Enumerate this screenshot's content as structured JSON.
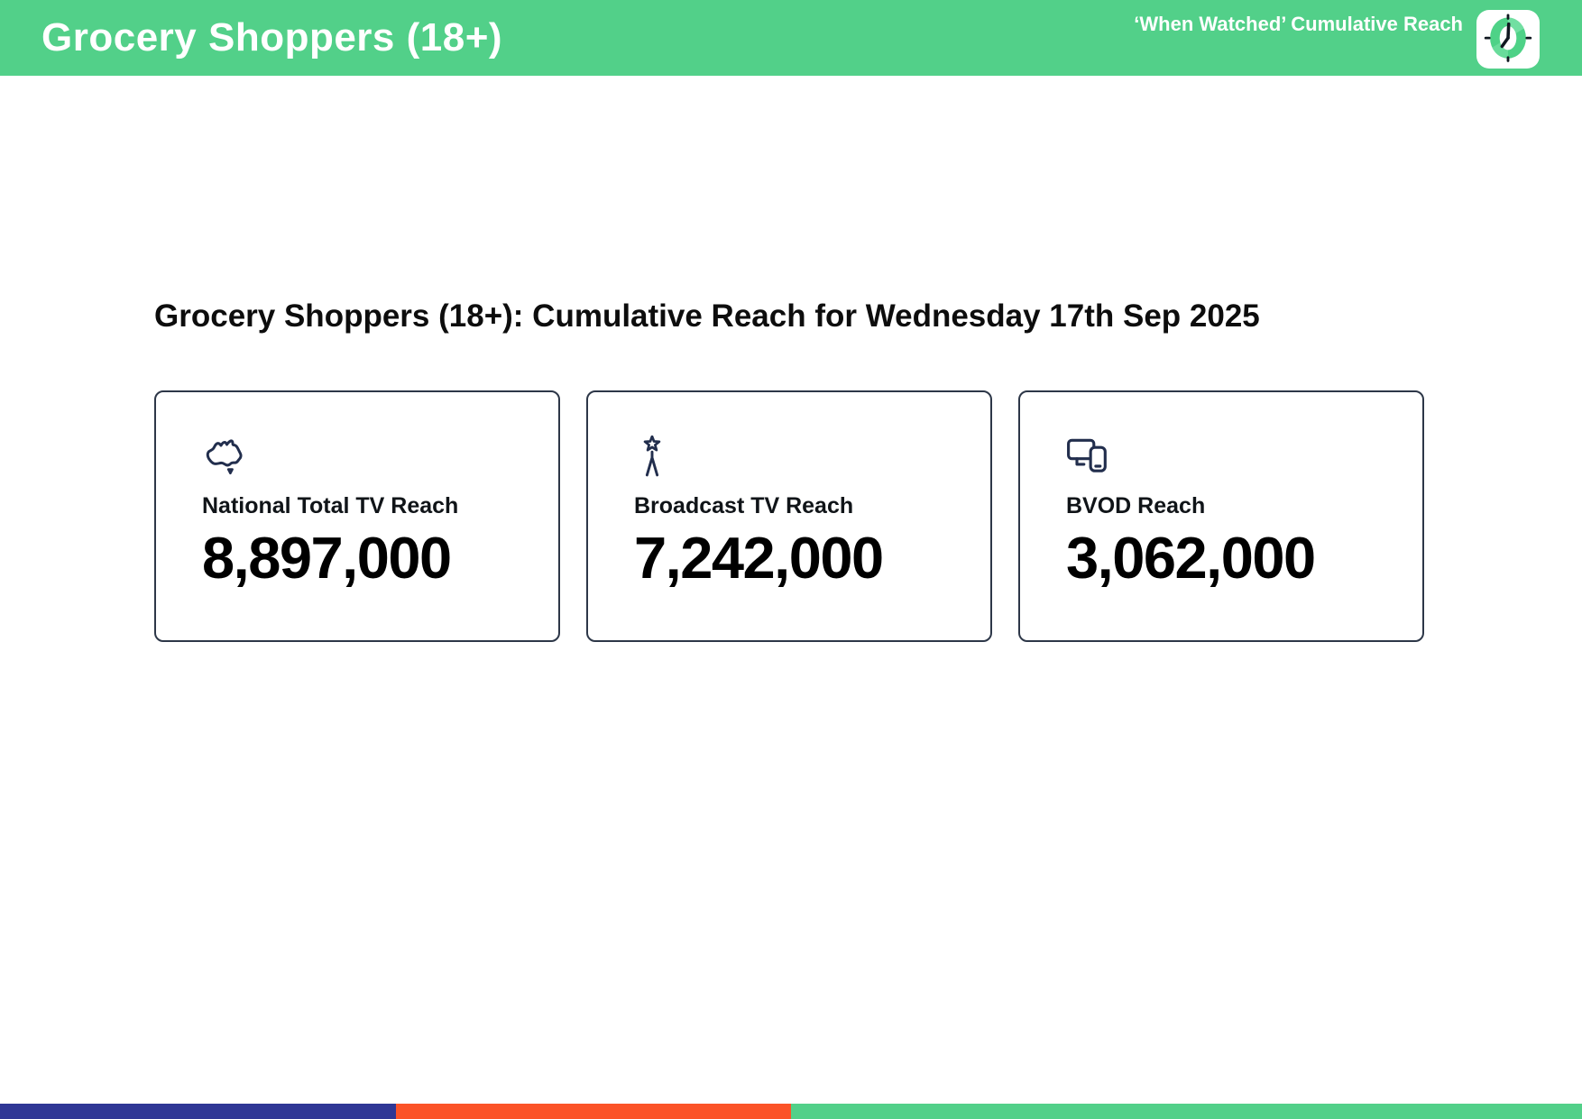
{
  "header": {
    "title": "Grocery Shoppers (18+)",
    "subtitle": "‘When Watched’ Cumulative Reach",
    "clock_icon": "clock-in-rounded-square"
  },
  "main": {
    "heading": "Grocery Shoppers (18+): Cumulative Reach for Wednesday 17th Sep 2025",
    "cards": [
      {
        "icon": "australia-map-icon",
        "label": "National Total TV Reach",
        "value": "8,897,000"
      },
      {
        "icon": "broadcast-tower-icon",
        "label": "Broadcast TV Reach",
        "value": "7,242,000"
      },
      {
        "icon": "devices-icon",
        "label": "BVOD Reach",
        "value": "3,062,000"
      }
    ]
  },
  "footer": {
    "segments": [
      {
        "name": "blue",
        "color": "#2f3795",
        "width_pct": 25
      },
      {
        "name": "orange",
        "color": "#fb5328",
        "width_pct": 25
      },
      {
        "name": "green",
        "color": "#52d089",
        "width_pct": 50
      }
    ]
  },
  "colors": {
    "header_green": "#52d089",
    "icon_navy": "#222e4d",
    "card_border": "#2d3748",
    "heading_text": "#0d0d0d",
    "value_text": "#000000"
  }
}
